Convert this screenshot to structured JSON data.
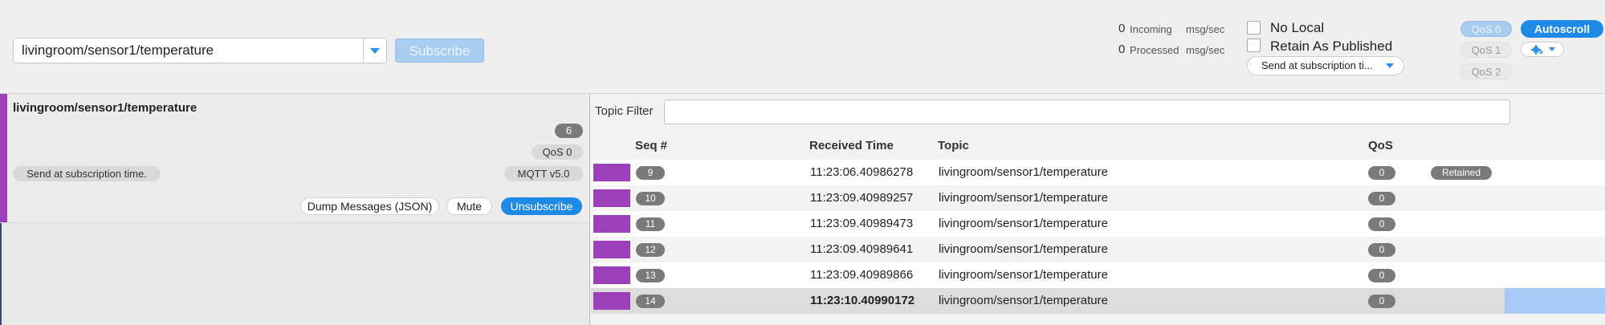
{
  "header": {
    "topic_input_value": "livingroom/sensor1/temperature",
    "subscribe_label": "Subscribe",
    "stats": [
      {
        "count": "0",
        "label": "Incoming",
        "unit": "msg/sec"
      },
      {
        "count": "0",
        "label": "Processed",
        "unit": "msg/sec"
      }
    ],
    "options": {
      "no_local_label": "No Local",
      "retain_as_published_label": "Retain As Published",
      "send_at_value": "Send at subscription ti..."
    },
    "qos_buttons": [
      "QoS 0",
      "QoS 1",
      "QoS 2"
    ],
    "qos_selected": "QoS 0",
    "autoscroll_label": "Autoscroll"
  },
  "subscription": {
    "topic": "livingroom/sensor1/temperature",
    "message_count": "6",
    "qos": "QoS 0",
    "retain_handling": "Send at subscription time.",
    "protocol": "MQTT v5.0",
    "dump_label": "Dump Messages (JSON)",
    "mute_label": "Mute",
    "unsubscribe_label": "Unsubscribe",
    "accent_color": "#9b3fbb"
  },
  "messages_panel": {
    "filter_label": "Topic Filter",
    "filter_value": "",
    "columns": {
      "seq": "Seq #",
      "time": "Received Time",
      "topic": "Topic",
      "qos": "QoS"
    },
    "rows": [
      {
        "seq": "9",
        "time": "11:23:06.40986278",
        "topic": "livingroom/sensor1/temperature",
        "qos": "0",
        "flag": "Retained",
        "selected": false
      },
      {
        "seq": "10",
        "time": "11:23:09.40989257",
        "topic": "livingroom/sensor1/temperature",
        "qos": "0",
        "flag": "",
        "selected": false
      },
      {
        "seq": "11",
        "time": "11:23:09.40989473",
        "topic": "livingroom/sensor1/temperature",
        "qos": "0",
        "flag": "",
        "selected": false
      },
      {
        "seq": "12",
        "time": "11:23:09.40989641",
        "topic": "livingroom/sensor1/temperature",
        "qos": "0",
        "flag": "",
        "selected": false
      },
      {
        "seq": "13",
        "time": "11:23:09.40989866",
        "topic": "livingroom/sensor1/temperature",
        "qos": "0",
        "flag": "",
        "selected": false
      },
      {
        "seq": "14",
        "time": "11:23:10.40990172",
        "topic": "livingroom/sensor1/temperature",
        "qos": "0",
        "flag": "",
        "selected": true
      }
    ]
  }
}
